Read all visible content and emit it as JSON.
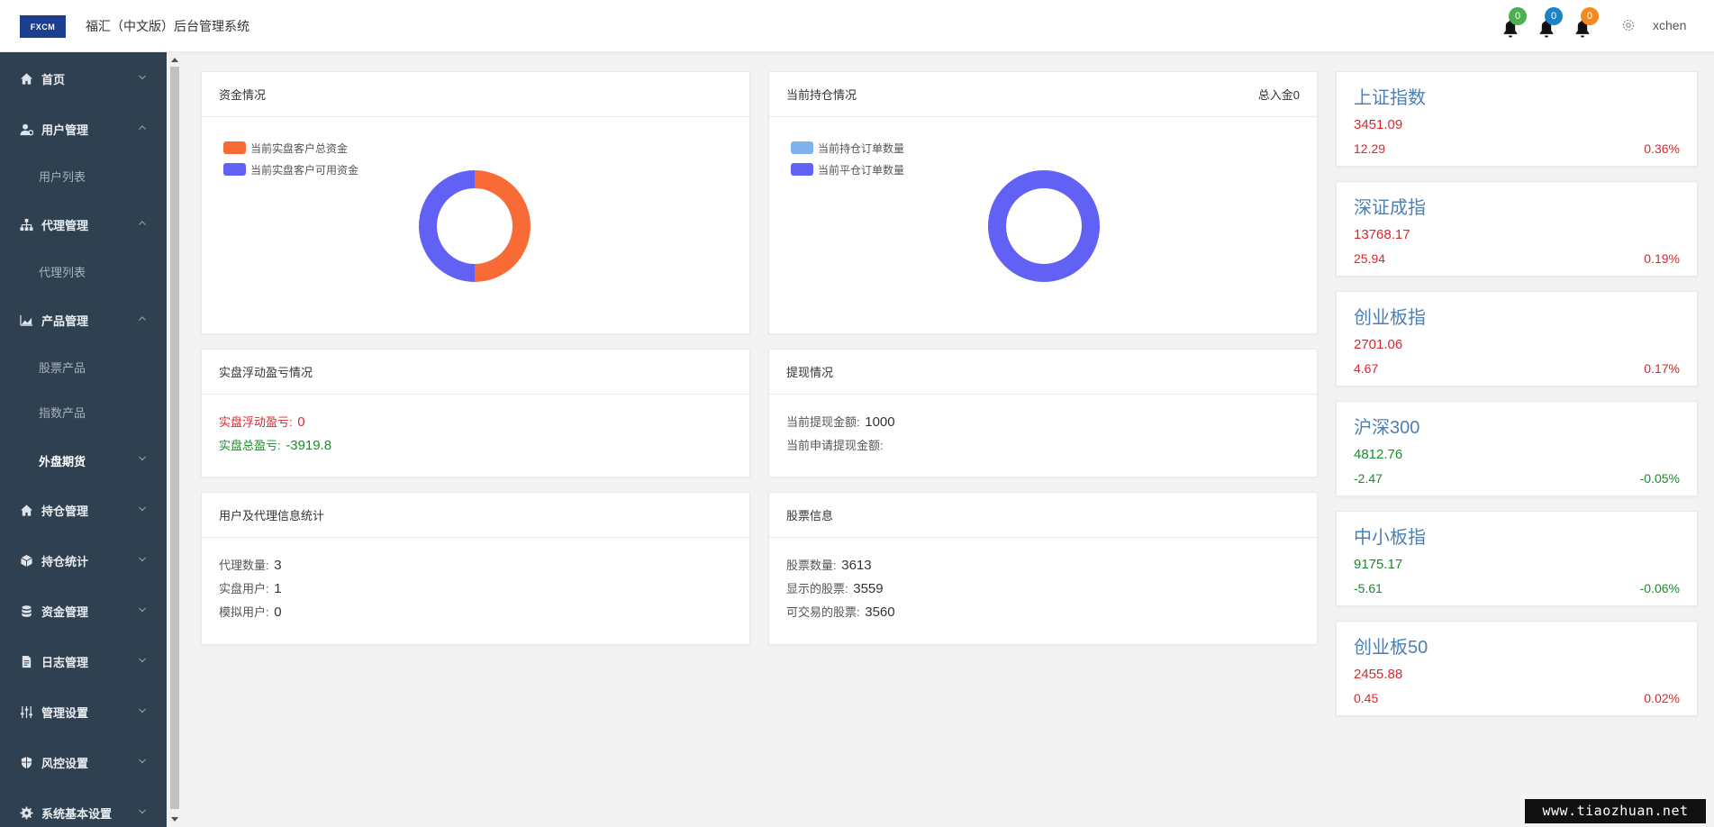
{
  "header": {
    "logo_text": "FXCM",
    "title": "福汇（中文版）后台管理系统",
    "notifications": [
      {
        "count": "0",
        "color": "#1ab394"
      },
      {
        "count": "0",
        "color": "#1c84c6"
      },
      {
        "count": "0",
        "color": "#f8ac59"
      }
    ],
    "username": "xchen"
  },
  "sidebar": {
    "items": [
      {
        "label": "首页",
        "icon": "home-icon"
      },
      {
        "label": "用户管理",
        "icon": "user-icon"
      },
      {
        "label": "用户列表"
      },
      {
        "label": "代理管理",
        "icon": "sitemap-icon"
      },
      {
        "label": "代理列表"
      },
      {
        "label": "产品管理",
        "icon": "chart-icon"
      },
      {
        "label": "股票产品"
      },
      {
        "label": "指数产品"
      },
      {
        "label": "外盘期货"
      },
      {
        "label": "持仓管理",
        "icon": "home-icon"
      },
      {
        "label": "持仓统计",
        "icon": "cube-icon"
      },
      {
        "label": "资金管理",
        "icon": "database-icon"
      },
      {
        "label": "日志管理",
        "icon": "file-icon"
      },
      {
        "label": "管理设置",
        "icon": "sliders-icon"
      },
      {
        "label": "风控设置",
        "icon": "shield-icon"
      },
      {
        "label": "系统基本设置",
        "icon": "gear-icon"
      }
    ]
  },
  "panels": {
    "funds": {
      "title": "资金情况",
      "legend": [
        "当前实盘客户总资金",
        "当前实盘客户可用资金"
      ],
      "colors": [
        "#f96b36",
        "#6161f5"
      ]
    },
    "positions": {
      "title": "当前持仓情况",
      "right_text": "总入金0",
      "legend": [
        "当前持仓订单数量",
        "当前平仓订单数量"
      ],
      "colors": [
        "#7fb2ef",
        "#6161f5"
      ]
    },
    "pnl": {
      "title": "实盘浮动盈亏情况",
      "floating_label": "实盘浮动盈亏:",
      "floating_value": "0",
      "total_label": "实盘总盈亏:",
      "total_value": "-3919.8"
    },
    "withdraw": {
      "title": "提现情况",
      "current_label": "当前提现金额:",
      "current_value": "1000",
      "apply_label": "当前申请提现金额:",
      "apply_value": ""
    },
    "users": {
      "title": "用户及代理信息统计",
      "agent_label": "代理数量:",
      "agent_value": "3",
      "real_label": "实盘用户:",
      "real_value": "1",
      "sim_label": "模拟用户:",
      "sim_value": "0"
    },
    "stocks": {
      "title": "股票信息",
      "count_label": "股票数量:",
      "count_value": "3613",
      "shown_label": "显示的股票:",
      "shown_value": "3559",
      "tradable_label": "可交易的股票:",
      "tradable_value": "3560"
    }
  },
  "indices": [
    {
      "name": "上证指数",
      "price": "3451.09",
      "change": "12.29",
      "pct": "0.36%",
      "dir": "up"
    },
    {
      "name": "深证成指",
      "price": "13768.17",
      "change": "25.94",
      "pct": "0.19%",
      "dir": "up"
    },
    {
      "name": "创业板指",
      "price": "2701.06",
      "change": "4.67",
      "pct": "0.17%",
      "dir": "up"
    },
    {
      "name": "沪深300",
      "price": "4812.76",
      "change": "-2.47",
      "pct": "-0.05%",
      "dir": "down"
    },
    {
      "name": "中小板指",
      "price": "9175.17",
      "change": "-5.61",
      "pct": "-0.06%",
      "dir": "down"
    },
    {
      "name": "创业板50",
      "price": "2455.88",
      "change": "0.45",
      "pct": "0.02%",
      "dir": "up"
    }
  ],
  "chart_data": [
    {
      "type": "pie",
      "series": [
        {
          "name": "当前实盘客户总资金",
          "values": [
            50
          ]
        },
        {
          "name": "当前实盘客户可用资金",
          "values": [
            50
          ]
        }
      ]
    },
    {
      "type": "pie",
      "series": [
        {
          "name": "当前持仓订单数量",
          "values": [
            0
          ]
        },
        {
          "name": "当前平仓订单数量",
          "values": [
            100
          ]
        }
      ]
    }
  ],
  "watermark": "www.tiaozhuan.net"
}
